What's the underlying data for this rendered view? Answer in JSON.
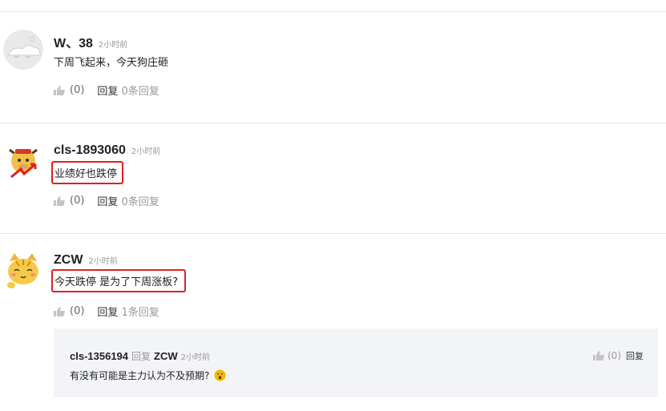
{
  "comments": [
    {
      "username": "W、38",
      "time": "2小时前",
      "content": "下周飞起来，今天狗庄砸",
      "like_count": "(0)",
      "reply_label": "回复",
      "reply_count": "0条回复",
      "avatar": "default-cloud-avatar"
    },
    {
      "username": "cls-1893060",
      "time": "2小时前",
      "content": "业绩好也跌停",
      "like_count": "(0)",
      "reply_label": "回复",
      "reply_count": "0条回复",
      "avatar": "ox-mascot-avatar",
      "highlighted": true
    },
    {
      "username": "ZCW",
      "time": "2小时前",
      "content": "今天跌停 是为了下周涨板?",
      "like_count": "(0)",
      "reply_label": "回复",
      "reply_count": "1条回复",
      "avatar": "cat-avatar",
      "highlighted": true
    }
  ],
  "reply": {
    "username": "cls-1356194",
    "reply_word": "回复",
    "target": "ZCW",
    "time": "2小时前",
    "content": "有没有可能是主力认为不及预期?",
    "like_count": "(0)",
    "reply_label": "回复",
    "emoji": "surprised-face-emoji"
  },
  "colors": {
    "highlight_border": "#e02020",
    "reply_background": "#f3f4f8",
    "separator": "#e8e8e8"
  }
}
